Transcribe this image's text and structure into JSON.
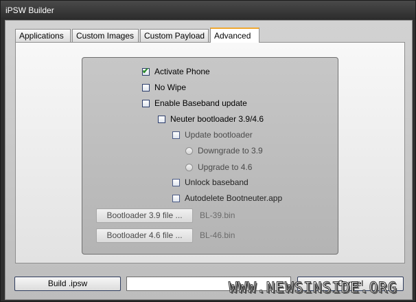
{
  "window": {
    "title": "iPSW Builder"
  },
  "tabs": [
    {
      "label": "Applications",
      "active": false
    },
    {
      "label": "Custom Images",
      "active": false
    },
    {
      "label": "Custom Payload",
      "active": false
    },
    {
      "label": "Advanced",
      "active": true
    }
  ],
  "options": {
    "activate_phone": {
      "label": "Activate Phone",
      "checked": true
    },
    "no_wipe": {
      "label": "No Wipe",
      "checked": false
    },
    "enable_baseband_update": {
      "label": "Enable Baseband update",
      "checked": false
    },
    "neuter_bootloader": {
      "label": "Neuter bootloader 3.9/4.6",
      "checked": false
    },
    "update_bootloader": {
      "label": "Update bootloader",
      "checked": false,
      "disabled": true
    },
    "downgrade": {
      "label": "Downgrade to 3.9",
      "selected": false,
      "disabled": true
    },
    "upgrade": {
      "label": "Upgrade to 4.6",
      "selected": false,
      "disabled": true
    },
    "unlock_baseband": {
      "label": "Unlock baseband",
      "checked": false,
      "disabled": true
    },
    "autodelete": {
      "label": "Autodelete Bootneuter.app",
      "checked": false,
      "disabled": true
    }
  },
  "bootloader_files": {
    "bl39_button": "Bootloader 3.9 file ...",
    "bl39_file": "BL-39.bin",
    "bl46_button": "Bootloader 4.6 file ...",
    "bl46_file": "BL-46.bin"
  },
  "bottom": {
    "build_label": "Build .ipsw",
    "cancel_label": "Cancel"
  },
  "watermark": "WWW.NEWSINSIDE.ORG",
  "colors": {
    "accent": "#f0a830",
    "check": "#2a8a2a",
    "titlebar": "#2c2c2c"
  }
}
